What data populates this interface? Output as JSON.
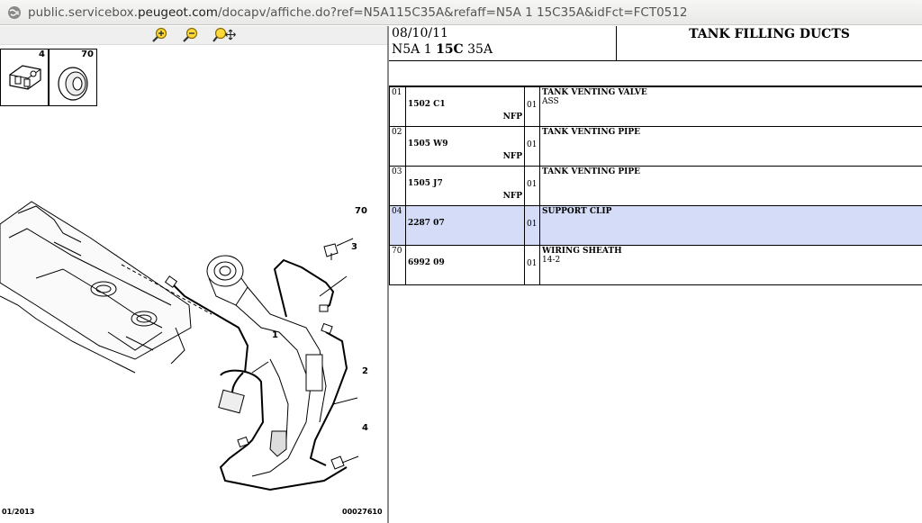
{
  "browser": {
    "url_prefix": "public.servicebox.",
    "url_host": "peugeot.com",
    "url_suffix": "/docapv/affiche.do?ref=N5A115C35A&refaff=N5A 1 15C35A&idFct=FCT0512"
  },
  "diagram": {
    "thumbnails": [
      {
        "num": "4"
      },
      {
        "num": "70"
      }
    ],
    "callouts": [
      "70",
      "3",
      "1",
      "2",
      "4"
    ],
    "footer_left": "01/2013",
    "footer_right": "00027610"
  },
  "header": {
    "date": "08/10/11",
    "code_a": "N5A 1 ",
    "code_b": "15C",
    "code_c": " 35A",
    "title": "TANK FILLING DUCTS"
  },
  "parts": [
    {
      "idx": "01",
      "ref": "1502 C1",
      "nfp": "NFP",
      "qty": "01",
      "desc": "TANK VENTING VALVE",
      "desc2": "ASS"
    },
    {
      "idx": "02",
      "ref": "1505 W9",
      "nfp": "NFP",
      "qty": "01",
      "desc": "TANK VENTING PIPE",
      "desc2": ""
    },
    {
      "idx": "03",
      "ref": "1505 J7",
      "nfp": "NFP",
      "qty": "01",
      "desc": "TANK VENTING PIPE",
      "desc2": ""
    },
    {
      "idx": "04",
      "ref": "2287 07",
      "nfp": "",
      "qty": "01",
      "desc": "SUPPORT CLIP",
      "desc2": "",
      "selected": true
    },
    {
      "idx": "70",
      "ref": "6992 09",
      "nfp": "",
      "qty": "01",
      "desc": "WIRING SHEATH",
      "desc2": "14-2"
    }
  ]
}
